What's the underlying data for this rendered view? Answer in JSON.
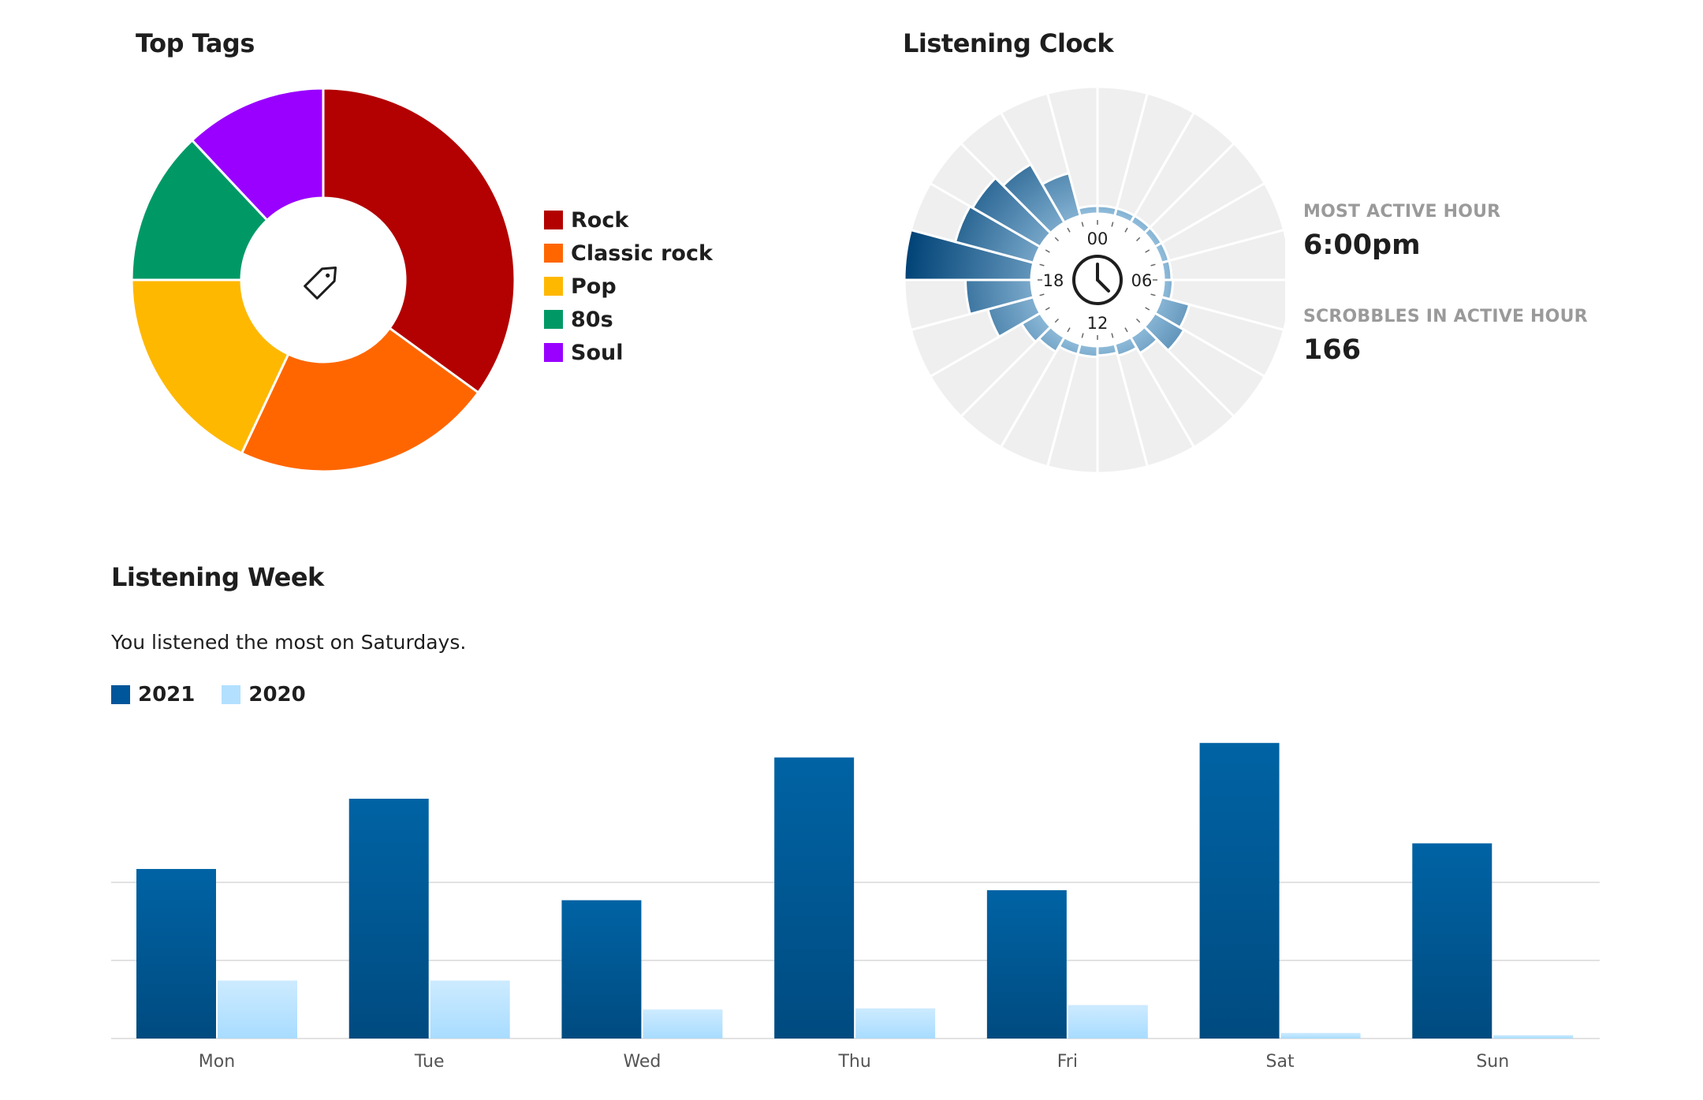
{
  "colors": {
    "rock": "#b30000",
    "classic_rock": "#ff6600",
    "pop": "#ffb800",
    "eighties": "#009966",
    "soul": "#9900ff",
    "series_2021": "#00569a",
    "series_2020": "#b3e0ff",
    "clock_background": "#efefef",
    "grid": "#e2e2e2"
  },
  "top_tags": {
    "title": "Top Tags",
    "center_icon": "tag-icon",
    "legend": [
      "Rock",
      "Classic rock",
      "Pop",
      "80s",
      "Soul"
    ]
  },
  "listening_clock": {
    "title": "Listening Clock",
    "center_icon": "clock-icon",
    "hour_labels": {
      "top": "00",
      "right": "06",
      "bottom": "12",
      "left": "18"
    },
    "most_active_hour_label": "MOST ACTIVE HOUR",
    "most_active_hour_value": "6:00pm",
    "scrobbles_label": "SCROBBLES IN ACTIVE HOUR",
    "scrobbles_value": "166"
  },
  "listening_week": {
    "title": "Listening Week",
    "subtitle": "You listened the most on Saturdays.",
    "legend": [
      "2021",
      "2020"
    ]
  },
  "chart_data": [
    {
      "type": "pie",
      "title": "Top Tags",
      "labels": [
        "Rock",
        "Classic rock",
        "Pop",
        "80s",
        "Soul"
      ],
      "values": [
        35,
        22,
        18,
        13,
        12
      ]
    },
    {
      "type": "bar",
      "title": "Listening Clock",
      "polar": true,
      "hours": [
        0,
        1,
        2,
        3,
        4,
        5,
        6,
        7,
        8,
        9,
        10,
        11,
        12,
        13,
        14,
        15,
        16,
        17,
        18,
        19,
        20,
        21,
        22,
        23
      ],
      "values": [
        8,
        8,
        6,
        4,
        3,
        10,
        12,
        38,
        44,
        24,
        16,
        12,
        14,
        14,
        22,
        28,
        62,
        86,
        166,
        106,
        102,
        88,
        58,
        6
      ],
      "max_hour": 18
    },
    {
      "type": "bar",
      "title": "Listening Week",
      "categories": [
        "Mon",
        "Tue",
        "Wed",
        "Thu",
        "Fri",
        "Sat",
        "Sun"
      ],
      "series": [
        {
          "name": "2021",
          "values": [
            152,
            215,
            124,
            252,
            133,
            265,
            175
          ]
        },
        {
          "name": "2020",
          "values": [
            52,
            52,
            26,
            27,
            30,
            5,
            3
          ]
        }
      ],
      "ylim": [
        0,
        280
      ],
      "grid": true
    }
  ]
}
